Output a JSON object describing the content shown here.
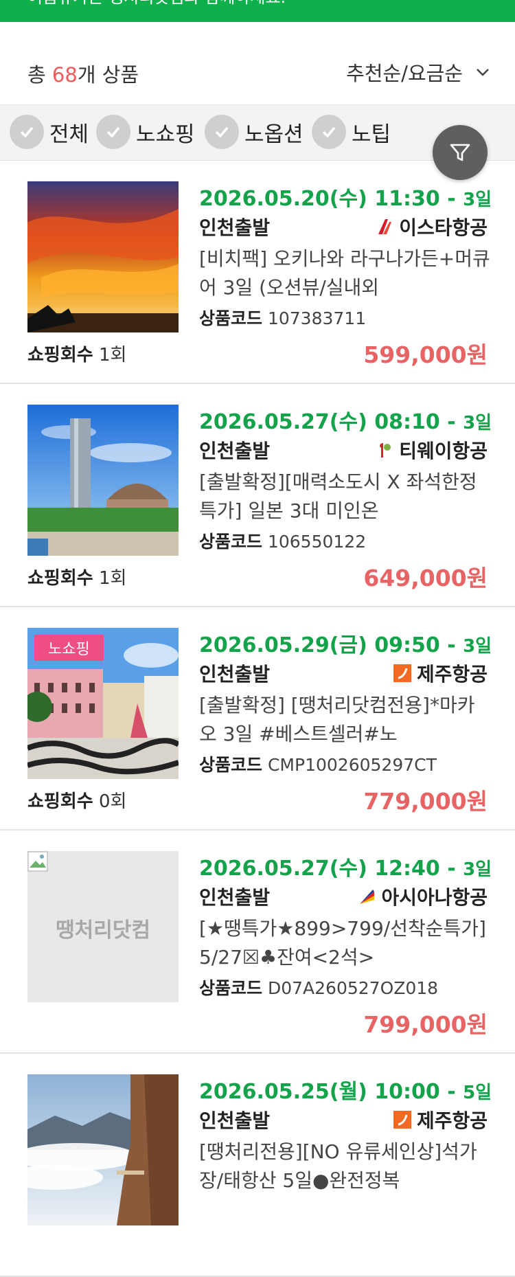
{
  "banner": {
    "text": "여름휴가는 땡처리닷컴과 함께하세요."
  },
  "summary": {
    "total_prefix": "총 ",
    "total_count": "68",
    "total_suffix": "개 상품",
    "sort_label": "추천순/요금순"
  },
  "filters": [
    {
      "label": "전체"
    },
    {
      "label": "노쇼핑"
    },
    {
      "label": "노옵션"
    },
    {
      "label": "노팁"
    }
  ],
  "colors": {
    "accent": "#13a34a",
    "price": "#e86363",
    "badge": "#ee4d86",
    "banner": "#0fb04b"
  },
  "products": [
    {
      "date": "2026.05.20(수) 11:30 -",
      "duration": "3일",
      "departure": "인천출발",
      "airline": "이스타항공",
      "airline_icon": "eastar-logo-icon",
      "title": "[비치팩] 오키나와 라구나가든+머큐어 3일 (오션뷰/실내외",
      "code_label": "상품코드",
      "code": "107383711",
      "shop_label": "쇼핑회수",
      "shop_count": "1회",
      "price": "599,000원",
      "image": "sunset-sky-photo"
    },
    {
      "date": "2026.05.27(수) 08:10 -",
      "duration": "3일",
      "departure": "인천출발",
      "airline": "티웨이항공",
      "airline_icon": "tway-logo-icon",
      "title": "[출발확정][매력소도시 X 좌석한정특가] 일본 3대 미인온",
      "code_label": "상품코드",
      "code": "106550122",
      "shop_label": "쇼핑회수",
      "shop_count": "1회",
      "price": "649,000원",
      "image": "tower-dome-photo"
    },
    {
      "badge": "노쇼핑",
      "date": "2026.05.29(금) 09:50 -",
      "duration": "3일",
      "departure": "인천출발",
      "airline": "제주항공",
      "airline_icon": "jejuair-logo-icon",
      "title": "[출발확정] [땡처리닷컴전용]*마카오 3일 #베스트셀러#노",
      "code_label": "상품코드",
      "code": "CMP1002605297CT",
      "shop_label": "쇼핑회수",
      "shop_count": "0회",
      "price": "779,000원",
      "image": "macau-square-photo"
    },
    {
      "date": "2026.05.27(수) 12:40 -",
      "duration": "3일",
      "departure": "인천출발",
      "airline": "아시아나항공",
      "airline_icon": "asiana-logo-icon",
      "title": "[★땡특가★899>799/선착순특가] 5/27☒♣잔여<2석>",
      "code_label": "상품코드",
      "code": "D07A260527OZ018",
      "price": "799,000원",
      "placeholder_logo": "땡처리닷컴",
      "image": "placeholder-image"
    },
    {
      "date": "2026.05.25(월) 10:00 -",
      "duration": "5일",
      "departure": "인천출발",
      "airline": "제주항공",
      "airline_icon": "jejuair-logo-icon",
      "title": "[땡처리전용][NO 유류세인상]석가장/태항산 5일●완전정복",
      "image": "cliff-mountain-photo"
    }
  ]
}
